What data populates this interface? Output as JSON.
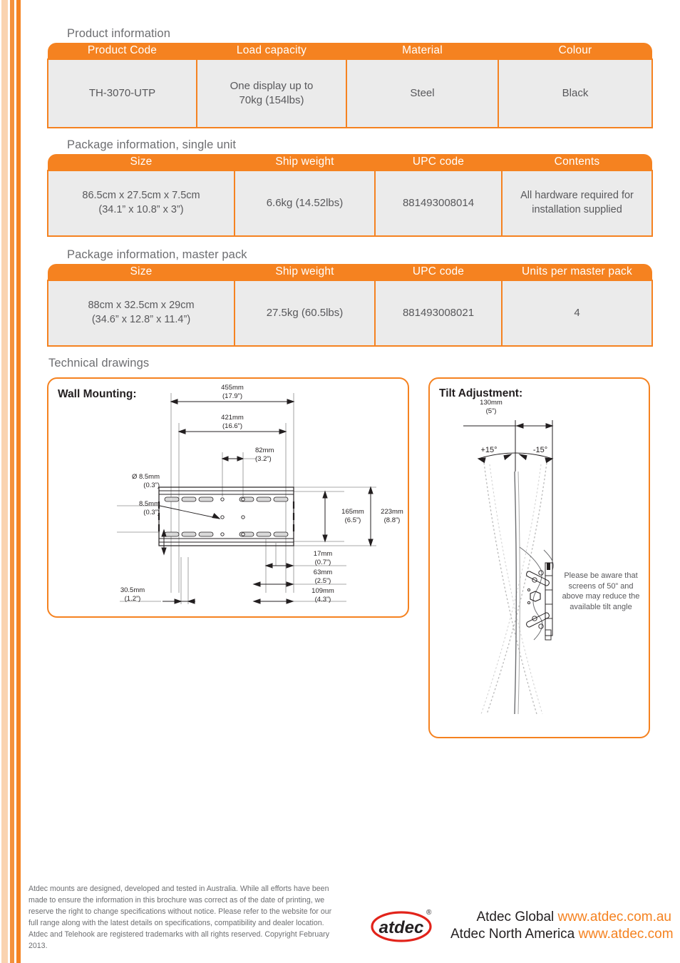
{
  "brand": {
    "accent": "#f58220",
    "stripe_light": "#fad3b0",
    "stripe_mid": "#f4913c",
    "logo_text": "atdec",
    "registered_mark": "®"
  },
  "sections": {
    "product_information": "Product information",
    "package_single": "Package information, single unit",
    "package_master": "Package information, master pack",
    "technical_drawings": "Technical drawings"
  },
  "product_table": {
    "headers": [
      "Product Code",
      "Load capacity",
      "Material",
      "Colour"
    ],
    "rows": [
      [
        "TH-3070-UTP",
        "One display up to\n70kg (154lbs)",
        "Steel",
        "Black"
      ]
    ],
    "cells": {
      "code": "TH-3070-UTP",
      "load_line1": "One display up to",
      "load_line2": "70kg (154lbs)",
      "material": "Steel",
      "colour": "Black"
    }
  },
  "package_single_table": {
    "headers": [
      "Size",
      "Ship weight",
      "UPC code",
      "Contents"
    ],
    "cells": {
      "size_line1": "86.5cm x 27.5cm x 7.5cm",
      "size_line2": "(34.1” x 10.8” x 3”)",
      "ship_weight": "6.6kg (14.52lbs)",
      "upc": "881493008014",
      "contents_line1": "All hardware required for",
      "contents_line2": "installation supplied"
    }
  },
  "package_master_table": {
    "headers": [
      "Size",
      "Ship weight",
      "UPC code",
      "Units per master pack"
    ],
    "cells": {
      "size_line1": "88cm x 32.5cm x 29cm",
      "size_line2": "(34.6” x 12.8” x 11.4”)",
      "ship_weight": "27.5kg (60.5lbs)",
      "upc": "881493008021",
      "units": "4"
    }
  },
  "wall_mounting": {
    "title": "Wall Mounting:",
    "dimensions": {
      "width_overall": "455mm\n(17.9”)",
      "width_inner": "421mm\n(16.6”)",
      "hole_spacing_82": "82mm\n(3.2”)",
      "hole_dia": "Ø 8.5mm\n(0.3”)",
      "slot_height": "8.5mm\n(0.3”)",
      "height_165": "165mm\n(6.5”)",
      "height_223": "223mm\n(8.8”)",
      "depth_17": "17mm\n(0.7”)",
      "depth_63": "63mm\n(2.5”)",
      "depth_109": "109mm\n(4.3”)",
      "depth_305": "30.5mm\n(1.2”)"
    }
  },
  "tilt_adjustment": {
    "title": "Tilt Adjustment:",
    "dimensions": {
      "depth_130": "130mm\n(5”)",
      "angle_plus": "+15°",
      "angle_minus": "-15°"
    },
    "note": "Please be aware that screens of 50” and above may reduce the available tilt angle"
  },
  "footer": {
    "disclaimer": "Atdec mounts are designed, developed and tested in Australia. While all efforts have been made to ensure the information in this brochure was correct as of the date of printing, we reserve the right to change specifications without notice. Please refer to the website for our full range along with the latest details on specifications, compatibility and dealer location. Atdec and Telehook are registered trademarks with all rights reserved. Copyright February 2013.",
    "brand_global_label": "Atdec Global",
    "brand_global_url": "www.atdec.com.au",
    "brand_na_label": "Atdec North America",
    "brand_na_url": "www.atdec.com"
  }
}
